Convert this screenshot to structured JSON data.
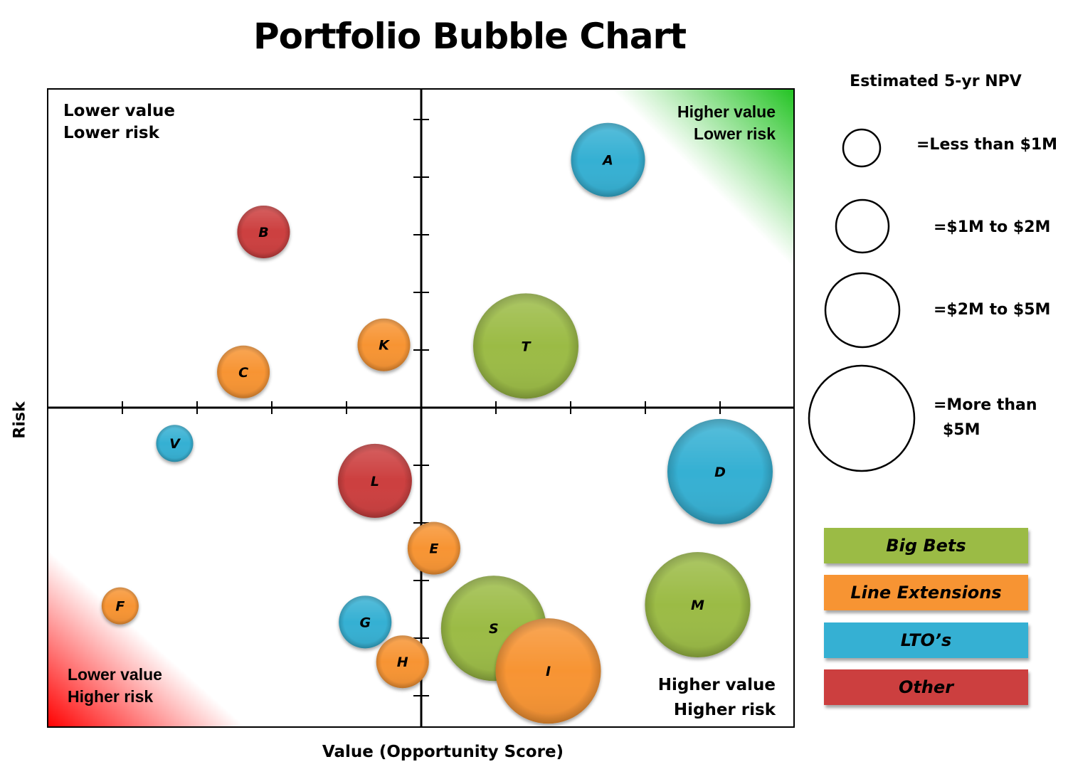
{
  "chart_data": {
    "type": "bubble",
    "title": "Portfolio Bubble Chart",
    "xlabel": "Value (Opportunity Score)",
    "ylabel": "Risk",
    "xlim": [
      -5,
      5
    ],
    "ylim": [
      -5.5,
      5.5
    ],
    "y_direction": "up = lower risk, down = higher risk",
    "x_ticks": [
      -4,
      -3,
      -2,
      -1,
      1,
      2,
      3,
      4
    ],
    "y_ticks": [
      -5,
      -4,
      -3,
      -2,
      -1,
      1,
      2,
      3,
      4,
      5
    ],
    "tick_labels_shown": false,
    "grid": false,
    "quadrant_labels": {
      "top_left": [
        "Lower value",
        "Lower risk"
      ],
      "top_right": [
        "Higher value",
        "Lower risk"
      ],
      "bottom_left": [
        "Lower value",
        "Higher risk"
      ],
      "bottom_right": [
        "Higher value",
        "Higher risk"
      ]
    },
    "categories": [
      {
        "name": "Big Bets",
        "color": "#9bbb45"
      },
      {
        "name": "Line Extensions",
        "color": "#f79433"
      },
      {
        "name": "LTO’s",
        "color": "#35b0d3"
      },
      {
        "name": "Other",
        "color": "#cc3f3f"
      }
    ],
    "size_legend": {
      "title": "Estimated 5-yr NPV",
      "levels": [
        {
          "label": "=Less than $1M",
          "size_class": 1
        },
        {
          "label": "=$1M to $2M",
          "size_class": 2
        },
        {
          "label": "=$2M to $5M",
          "size_class": 3
        },
        {
          "label": "=More than $5M",
          "size_class": 4,
          "lines": [
            "=More than",
            "$5M"
          ]
        }
      ]
    },
    "points": [
      {
        "label": "A",
        "x": 2.5,
        "y": 4.3,
        "size_class": 3,
        "category": "LTO’s"
      },
      {
        "label": "B",
        "x": -2.11,
        "y": 3.05,
        "size_class": 2,
        "category": "Other"
      },
      {
        "label": "C",
        "x": -2.38,
        "y": 0.62,
        "size_class": 2,
        "category": "Line Extensions"
      },
      {
        "label": "K",
        "x": -0.5,
        "y": 1.09,
        "size_class": 2,
        "category": "Line Extensions"
      },
      {
        "label": "T",
        "x": 1.4,
        "y": 1.07,
        "size_class": 4,
        "category": "Big Bets"
      },
      {
        "label": "V",
        "x": -3.3,
        "y": -0.62,
        "size_class": 1,
        "category": "LTO’s"
      },
      {
        "label": "L",
        "x": -0.62,
        "y": -1.27,
        "size_class": 3,
        "category": "Other"
      },
      {
        "label": "E",
        "x": 0.17,
        "y": -2.44,
        "size_class": 2,
        "category": "Line Extensions"
      },
      {
        "label": "F",
        "x": -4.03,
        "y": -3.44,
        "size_class": 1,
        "category": "Line Extensions"
      },
      {
        "label": "G",
        "x": -0.75,
        "y": -3.72,
        "size_class": 2,
        "category": "LTO’s"
      },
      {
        "label": "H",
        "x": -0.25,
        "y": -4.41,
        "size_class": 2,
        "category": "Line Extensions"
      },
      {
        "label": "D",
        "x": 4.0,
        "y": -1.11,
        "size_class": 4,
        "category": "LTO’s"
      },
      {
        "label": "M",
        "x": 3.7,
        "y": -3.42,
        "size_class": 4,
        "category": "Big Bets"
      },
      {
        "label": "S",
        "x": 0.97,
        "y": -3.83,
        "size_class": 4,
        "category": "Big Bets"
      },
      {
        "label": "I",
        "x": 1.7,
        "y": -4.57,
        "size_class": 4,
        "category": "Line Extensions"
      }
    ],
    "corner_highlights": {
      "top_right": "#22c322",
      "bottom_left": "#ff0000"
    }
  }
}
